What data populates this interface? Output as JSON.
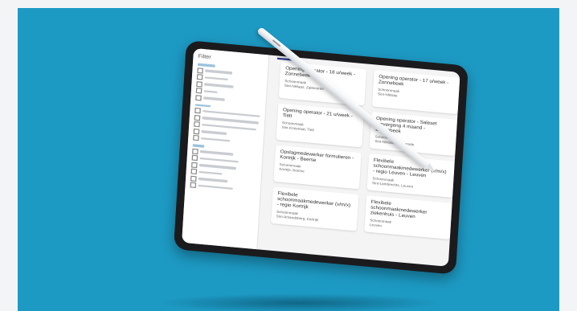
{
  "scene": {
    "background_color": "#1d9ac4"
  },
  "tablet": {
    "sidebar": {
      "title": "Filter",
      "sections": [
        {
          "items": 6
        },
        {
          "items": 6
        },
        {
          "items": 7
        }
      ]
    },
    "cards": [
      {
        "title": "Opening operator - 18 u/week - Zonnebeek",
        "meta": [
          "Schoonmaak",
          "Sint-Niklaas, Zaltboorde"
        ]
      },
      {
        "title": "Opening operator - 17 u/week - Zonnebeek",
        "meta": [
          "Schoonmaak",
          "Sint-Niklaas"
        ]
      },
      {
        "title": "Opening operator - 21 u/week - Tielt",
        "meta": [
          "Schoonmaak",
          "Sint-Kruistraat, Tielt"
        ]
      },
      {
        "title": "Opening operator - Saleset omvergeng 4 maand - Zonnebeek",
        "meta": [
          "Schoonmaak",
          "Sint-Niklaas, Zaltboorde"
        ]
      },
      {
        "title": "Opslagmedewerker formulieren - Kortrijk - Beerse",
        "meta": [
          "Schoonmaak",
          "Kortrijk, Beerse"
        ]
      },
      {
        "title": "Flexibele schoonmaakmedewerker (v/m/x) - regio Leuven - Leuven",
        "meta": [
          "Schoonmaak",
          "Sint-Lambrechts, Leuven"
        ]
      },
      {
        "title": "Flexibele schoonmaakmedewerker (v/m/x) - regio Kortrijk",
        "meta": [
          "Schoonmaak",
          "Sint-Amandsberg, Kortrijk"
        ]
      },
      {
        "title": "Flexibele schoonmaakmedewerker ziekenhuis - Leuven",
        "meta": [
          "Schoonmaak",
          "Leuven"
        ]
      }
    ]
  }
}
